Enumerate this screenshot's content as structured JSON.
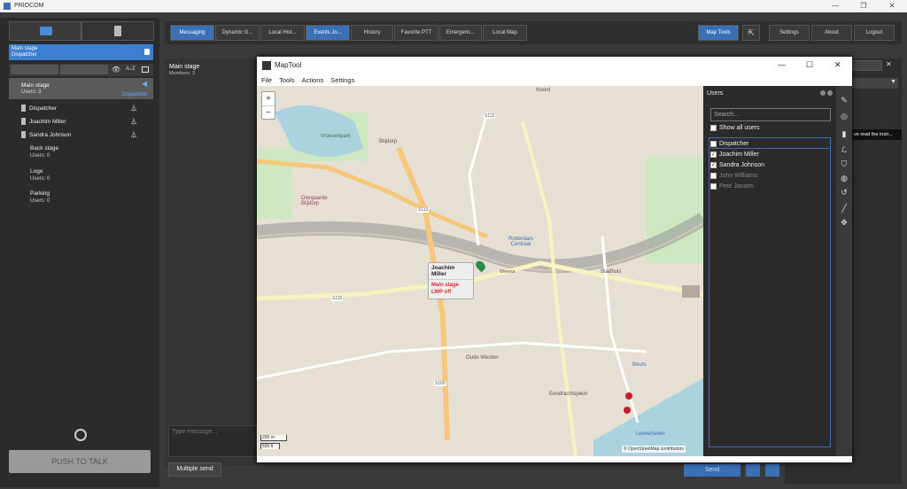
{
  "app": {
    "title": "PRIOCOM"
  },
  "left": {
    "dispatcher_stage": {
      "title": "Main stage",
      "subtitle": "Dispatcher"
    },
    "main_group": {
      "name": "Main stage",
      "users": "Users: 3",
      "role": "Dispatcher"
    },
    "users": [
      "Dispatcher",
      "Joachim Miller",
      "Sandra Johnson"
    ],
    "groups": [
      {
        "name": "Back stage",
        "users": "Users: 0"
      },
      {
        "name": "Loge",
        "users": "Users: 0"
      },
      {
        "name": "Parking",
        "users": "Users: 0"
      }
    ],
    "ptt_label": "PUSH TO TALK"
  },
  "toolbar": {
    "tabs": [
      "Messaging",
      "Dynamic G...",
      "Local Hist...",
      "Events Jo...",
      "History",
      "Favorite PTT",
      "Emergenc...",
      "Local Map"
    ],
    "map_tools": "Map Tools",
    "settings": "Settings",
    "about": "About",
    "logout": "Logout"
  },
  "main": {
    "title": "Main stage",
    "members": "Members: 3",
    "input_placeholder": "Type message...",
    "multiple_send": "Multiple send",
    "send": "Send",
    "right_hint": "ve read the instr..."
  },
  "maptool": {
    "title": "MapTool",
    "menu": [
      "File",
      "Tools",
      "Actions",
      "Settings"
    ],
    "users_title": "Users",
    "search_placeholder": "Search...",
    "show_all": "Show all users",
    "user_list": [
      {
        "name": "Dispatcher",
        "checked": false,
        "dim": false
      },
      {
        "name": "Joachim Miller",
        "checked": true,
        "dim": false
      },
      {
        "name": "Sandra Johnson",
        "checked": true,
        "dim": false
      },
      {
        "name": "John Williams",
        "checked": false,
        "dim": true
      },
      {
        "name": "Pete Jansen",
        "checked": false,
        "dim": true
      }
    ],
    "popup": {
      "name": "Joachim Miller",
      "stage": "Main stage",
      "status": "LWP off"
    },
    "map_labels": {
      "vroesenpark": "Vroesenpark",
      "blijdorp": "Blijdorp",
      "diergaarde": "Diergaarde Blijdorp",
      "station": "Rotterdam Centraal",
      "oude_westen": "Oude Westen",
      "stadhuis": "Stadhuis",
      "eendrachtsplein": "Eendrachtsplein",
      "leuvehaven": "Leuvehaven",
      "noord": "Noord",
      "beurs": "Beurs",
      "weena": "Weena",
      "s112": "S112",
      "s113": "S113",
      "s100": "S100",
      "s115": "S115"
    },
    "scale": {
      "m": "200 m",
      "ft": "500 ft"
    },
    "attribution": "© OpenStreetMap contributors"
  }
}
